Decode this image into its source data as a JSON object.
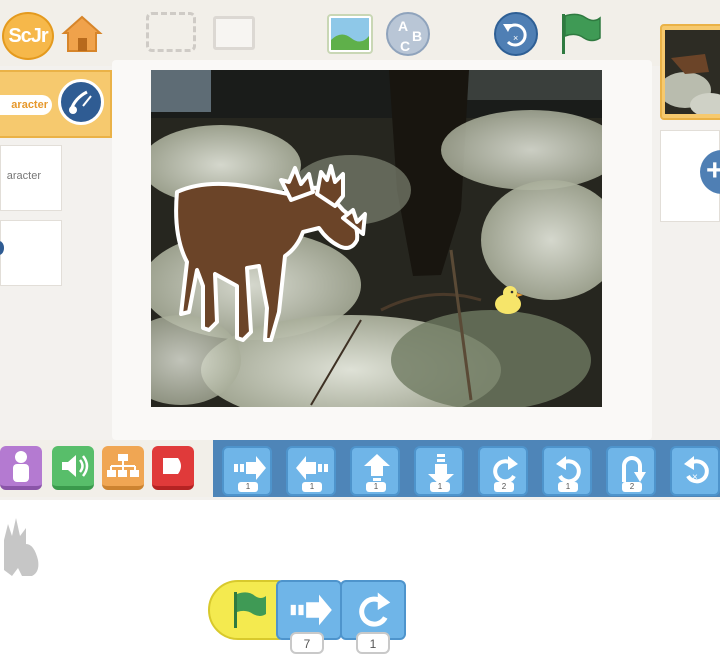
{
  "top_bar": {
    "logo_text": "ScJr",
    "icons": [
      "home-icon",
      "fullscreen-icon",
      "grid-icon",
      "background-picture-icon",
      "text-abc-icon",
      "reset-characters-icon",
      "green-flag-icon"
    ],
    "text_button_letters": [
      "A",
      "B",
      "C"
    ]
  },
  "characters_panel": {
    "selected_name": "aracter",
    "second_name": "aracter"
  },
  "stage": {
    "description_sprites": [
      "moose-sprite",
      "chick-sprite"
    ]
  },
  "palette": {
    "categories": [
      "looks",
      "sound",
      "control",
      "end"
    ],
    "blocks": [
      {
        "name": "move-right-block",
        "count": "1"
      },
      {
        "name": "move-left-block",
        "count": "1"
      },
      {
        "name": "move-up-block",
        "count": "1"
      },
      {
        "name": "move-down-block",
        "count": "1"
      },
      {
        "name": "turn-right-block",
        "count": "2"
      },
      {
        "name": "turn-left-block",
        "count": "1"
      },
      {
        "name": "hop-block",
        "count": "2"
      },
      {
        "name": "go-home-block",
        "count": ""
      }
    ]
  },
  "script": {
    "move_param": "7",
    "rotate_param": "1"
  },
  "colors": {
    "motion_blue": "#6fb5e8",
    "palette_blue": "#4e85b8",
    "trigger_yellow": "#f4ea4f",
    "flag_green": "#3f9a55",
    "accent_orange": "#f6c96e"
  }
}
